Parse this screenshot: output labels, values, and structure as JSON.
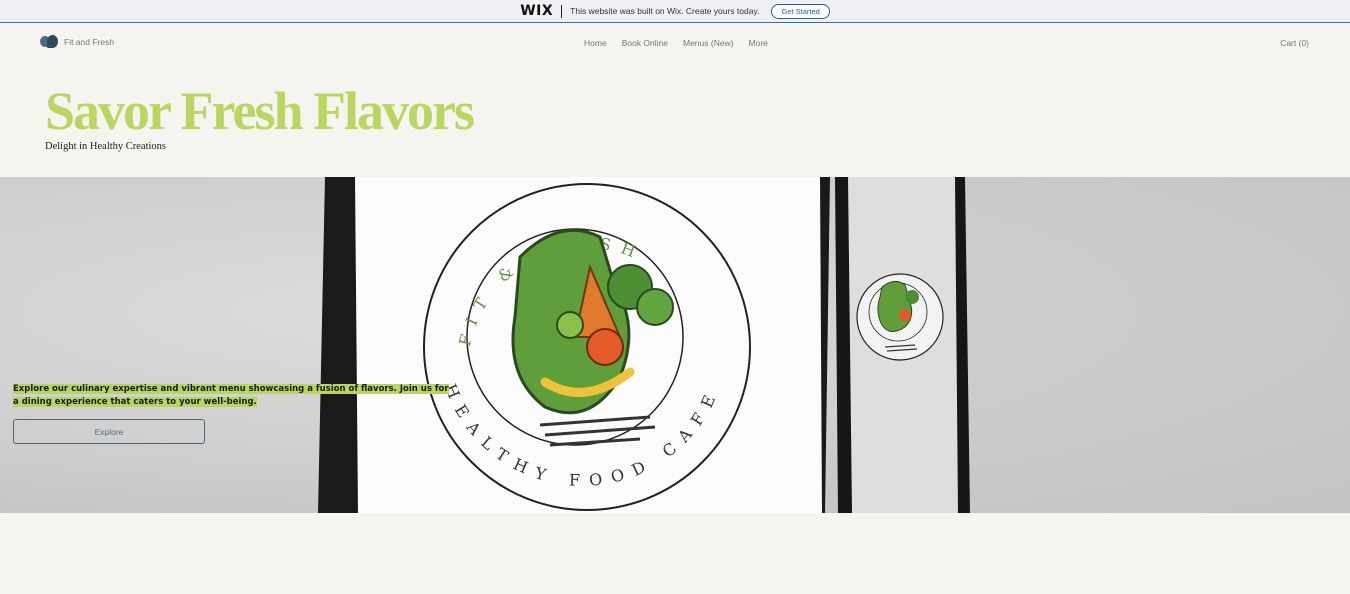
{
  "wix_banner": {
    "logo": "WIX",
    "message": "This website was built on Wix. Create yours today.",
    "cta": "Get Started"
  },
  "header": {
    "brand_name": "Fit and Fresh",
    "nav": [
      "Home",
      "Book Online",
      "Menus (New)",
      "More"
    ],
    "cart": "Cart (0)"
  },
  "hero": {
    "title": "Savor Fresh Flavors",
    "subtitle": "Delight in Healthy Creations"
  },
  "banner": {
    "text": "Explore our culinary expertise and vibrant menu showcasing a fusion of flavors. Join us for a dining experience that caters to your well-being.",
    "button": "Explore",
    "logo_top_text": "FIT & FRESH",
    "logo_bottom_text": "HEALTHY FOOD CAFE"
  },
  "colors": {
    "accent_green": "#b8d660",
    "highlight_green": "#b7d65e",
    "wix_blue": "#1f5fb5",
    "nav_text": "#6a7b86",
    "page_bg": "#f5f4ef"
  }
}
